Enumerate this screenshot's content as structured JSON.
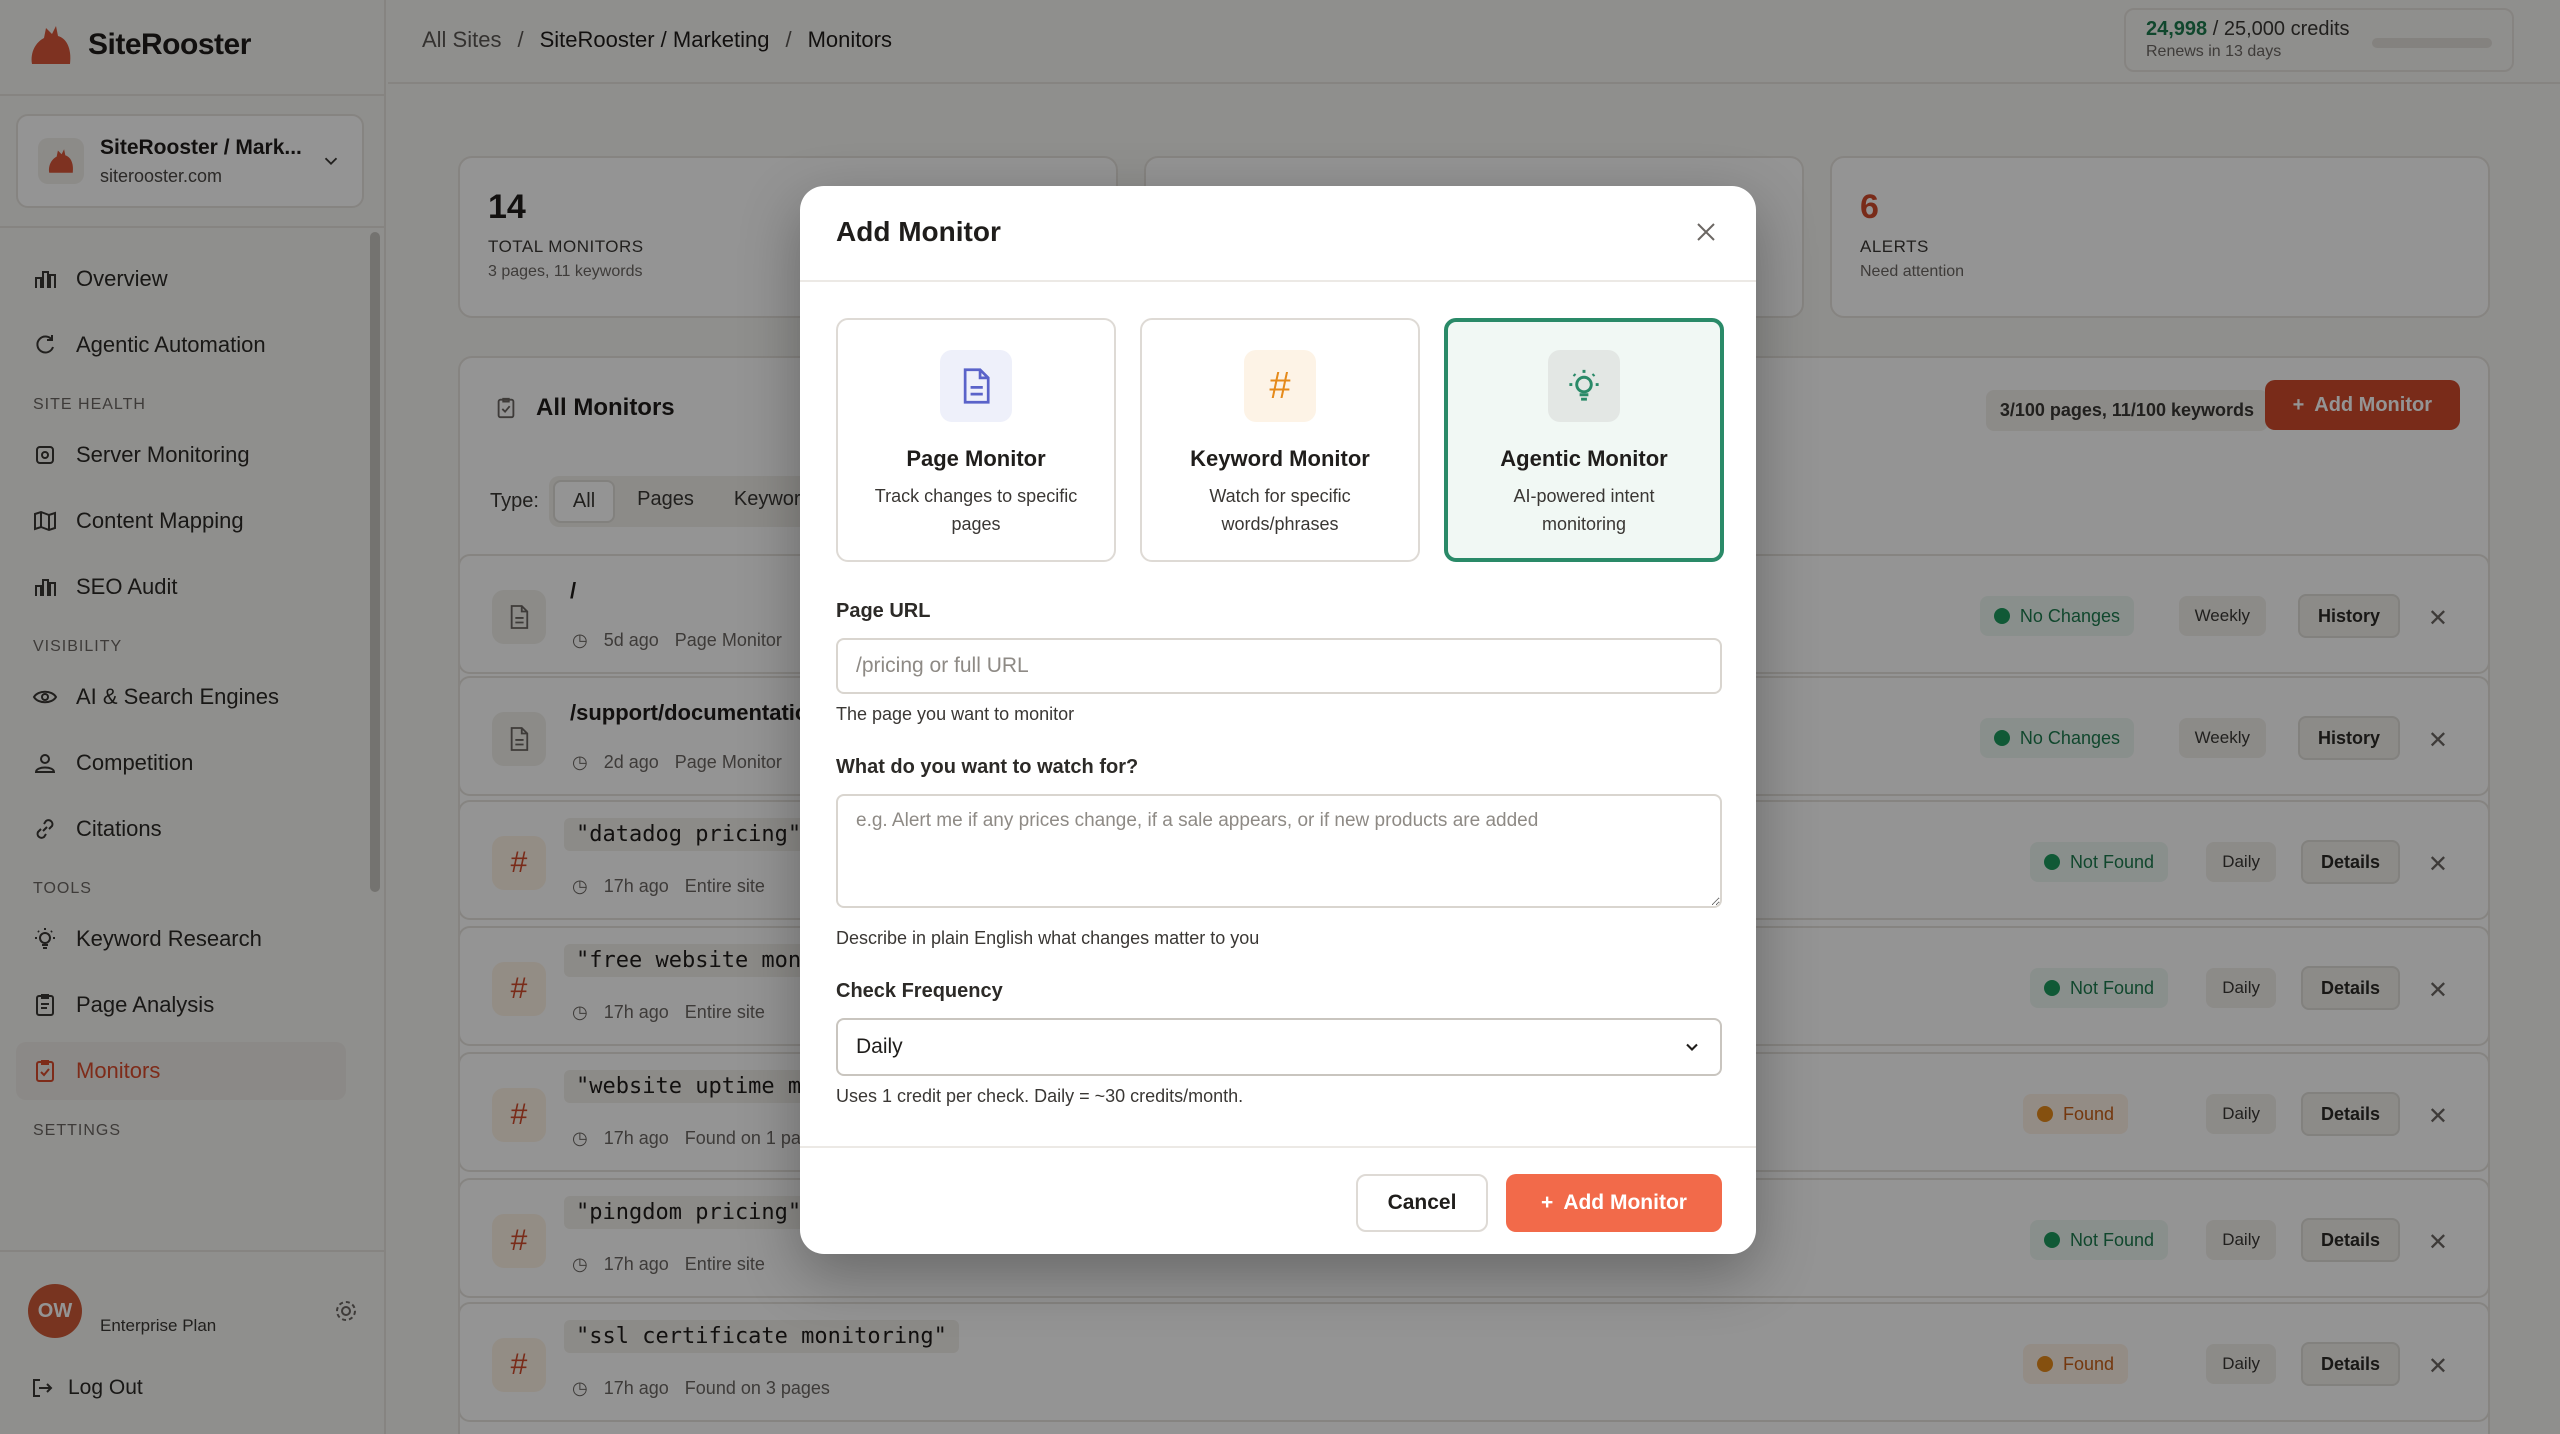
{
  "app": {
    "name": "SiteRooster"
  },
  "site_switcher": {
    "name": "SiteRooster / Mark...",
    "domain": "siterooster.com"
  },
  "nav": {
    "top": [
      {
        "label": "Overview",
        "icon": "bar-chart-icon"
      },
      {
        "label": "Agentic Automation",
        "icon": "refresh-icon"
      }
    ],
    "site_health_heading": "SITE HEALTH",
    "site_health": [
      {
        "label": "Server Monitoring",
        "icon": "server-icon"
      },
      {
        "label": "Content Mapping",
        "icon": "map-icon"
      },
      {
        "label": "SEO Audit",
        "icon": "bar-chart-icon"
      }
    ],
    "visibility_heading": "VISIBILITY",
    "visibility": [
      {
        "label": "AI & Search Engines",
        "icon": "eye-icon"
      },
      {
        "label": "Competition",
        "icon": "user-icon"
      },
      {
        "label": "Citations",
        "icon": "link-icon"
      }
    ],
    "tools_heading": "TOOLS",
    "tools": [
      {
        "label": "Keyword Research",
        "icon": "lightbulb-icon"
      },
      {
        "label": "Page Analysis",
        "icon": "clipboard-icon"
      },
      {
        "label": "Monitors",
        "icon": "clipboard-check-icon",
        "active": true
      }
    ],
    "settings_heading": "SETTINGS"
  },
  "user": {
    "initials": "OW",
    "plan": "Enterprise Plan"
  },
  "logout": "Log Out",
  "breadcrumbs": [
    "All Sites",
    "/",
    "SiteRooster / Marketing",
    "/",
    "Monitors"
  ],
  "credits": {
    "used": "24,998",
    "sep": "/ 25,000",
    "unit": "credits",
    "renews": "Renews in 13 days"
  },
  "stats": {
    "total": {
      "value": "14",
      "label": "TOTAL MONITORS",
      "sub": "3 pages, 11 keywords"
    },
    "alerts": {
      "value": "6",
      "label": "ALERTS",
      "sub": "Need attention"
    }
  },
  "panel": {
    "title": "All Monitors",
    "usage": "3/100 pages, 11/100 keywords",
    "add_label": "Add Monitor",
    "type_label": "Type:",
    "types": [
      "All",
      "Pages",
      "Keywor"
    ]
  },
  "rows": [
    {
      "title": "/",
      "age": "5d ago",
      "scope": "Page Monitor",
      "status": "No Changes",
      "freq": "Weekly",
      "action": "History",
      "kind": "page"
    },
    {
      "title": "/support/documentatio",
      "age": "2d ago",
      "scope": "Page Monitor",
      "status": "No Changes",
      "freq": "Weekly",
      "action": "History",
      "kind": "page"
    },
    {
      "title": "\"datadog pricing\"",
      "age": "17h ago",
      "scope": "Entire site",
      "status": "Not Found",
      "freq": "Daily",
      "action": "Details",
      "kind": "keyword"
    },
    {
      "title": "\"free website monit",
      "age": "17h ago",
      "scope": "Entire site",
      "status": "Not Found",
      "freq": "Daily",
      "action": "Details",
      "kind": "keyword"
    },
    {
      "title": "\"website uptime mon",
      "age": "17h ago",
      "scope": "Found on 1 page",
      "status": "Found",
      "freq": "Daily",
      "action": "Details",
      "kind": "keyword"
    },
    {
      "title": "\"pingdom pricing\"",
      "age": "17h ago",
      "scope": "Entire site",
      "status": "Not Found",
      "freq": "Daily",
      "action": "Details",
      "kind": "keyword"
    },
    {
      "title": "\"ssl certificate monitoring\"",
      "age": "17h ago",
      "scope": "Found on 3 pages",
      "status": "Found",
      "freq": "Daily",
      "action": "Details",
      "kind": "keyword"
    }
  ],
  "modal": {
    "title": "Add Monitor",
    "types": [
      {
        "title": "Page Monitor",
        "desc": "Track changes to specific pages",
        "icon": "document-icon"
      },
      {
        "title": "Keyword Monitor",
        "desc": "Watch for specific words/phrases",
        "icon": "hash-icon"
      },
      {
        "title": "Agentic Monitor",
        "desc": "AI-powered intent monitoring",
        "icon": "lightbulb-icon",
        "selected": true
      }
    ],
    "url_label": "Page URL",
    "url_placeholder": "/pricing or full URL",
    "url_value": "",
    "url_help": "The page you want to monitor",
    "watch_label": "What do you want to watch for?",
    "watch_placeholder": "e.g. Alert me if any prices change, if a sale appears, or if new products are added",
    "watch_help": "Describe in plain English what changes matter to you",
    "freq_label": "Check Frequency",
    "freq_value": "Daily",
    "freq_help": "Uses 1 credit per check. Daily = ~30 credits/month.",
    "cancel_label": "Cancel",
    "submit_label": "Add Monitor"
  },
  "colors": {
    "brand": "#d04a2c",
    "accent_green": "#2a8a68",
    "submit": "#f26a4a"
  }
}
